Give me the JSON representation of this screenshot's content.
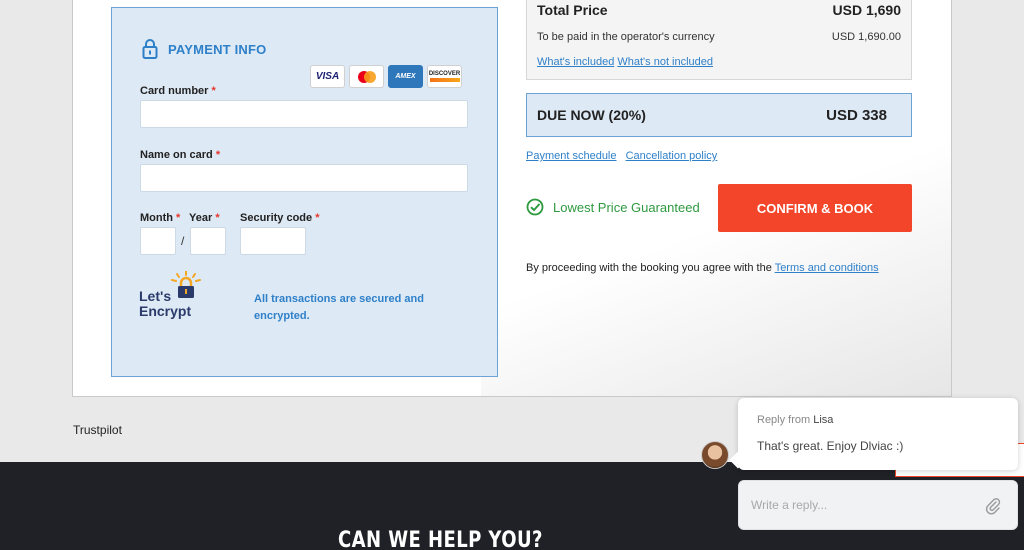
{
  "payment": {
    "title": "PAYMENT INFO",
    "cards": [
      "VISA",
      "mastercard-icon",
      "AMEX",
      "DISCOVER"
    ],
    "card_number_label": "Card number",
    "name_on_card_label": "Name on card",
    "month_label": "Month",
    "year_label": "Year",
    "security_code_label": "Security code",
    "required_mark": "*",
    "date_separator": "/",
    "lets_encrypt_line1": "Let's",
    "lets_encrypt_line2": "Encrypt",
    "secure_text": "All transactions are secured and encrypted."
  },
  "price": {
    "total_label": "Total Price",
    "total_value": "USD 1,690",
    "operator_label": "To be paid in the operator's currency",
    "operator_value": "USD 1,690.00",
    "whats_included": "What's included",
    "whats_not_included": "What's not included"
  },
  "due": {
    "label": "DUE NOW (20%)",
    "amount": "USD 338"
  },
  "links": {
    "payment_schedule": "Payment schedule",
    "cancellation_policy": "Cancellation policy"
  },
  "guarantee": {
    "text": "Lowest Price Guaranteed"
  },
  "confirm": {
    "label": "CONFIRM & BOOK"
  },
  "agreement": {
    "text": "By proceeding with the booking you agree with the ",
    "link": "Terms and conditions"
  },
  "trustpilot": "Trustpilot",
  "footer": {
    "heading": "CAN WE HELP YOU?"
  },
  "chat": {
    "reply_from": "Reply from",
    "agent_name": "Lisa",
    "message": "That's great. Enjoy Dlviac :)",
    "reply_placeholder": "Write a reply..."
  },
  "colors": {
    "accent_blue": "#2e80c9",
    "confirm_red": "#f2452a",
    "guarantee_green": "#2e9a3f",
    "footer_dark": "#1f2127"
  }
}
